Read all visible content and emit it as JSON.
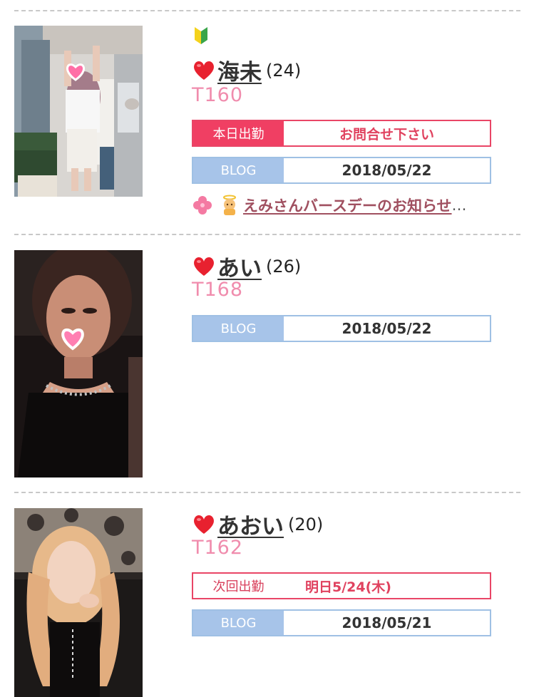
{
  "colors": {
    "divider": "#c8c8c8",
    "shift_accent": "#f03f63",
    "blog_accent": "#a7c4e9",
    "height_text": "#f08cad",
    "name_text": "#333333"
  },
  "entries": [
    {
      "name": "海未",
      "age": "(24)",
      "height": "T160",
      "beginner_mark": true,
      "heart_icon": "heart-icon",
      "photo_icon": "photo",
      "shift": {
        "label": "本日出勤",
        "value": "お問合せ下さい"
      },
      "blog": {
        "label": "BLOG",
        "date": "2018/05/22"
      },
      "news": {
        "text": "えみさんバースデーのお知らせ",
        "ellipsis": "…"
      }
    },
    {
      "name": "あい",
      "age": "(26)",
      "height": "T168",
      "beginner_mark": false,
      "heart_icon": "heart-icon",
      "photo_icon": "photo",
      "blog": {
        "label": "BLOG",
        "date": "2018/05/22"
      }
    },
    {
      "name": "あおい",
      "age": "(20)",
      "height": "T162",
      "beginner_mark": false,
      "heart_icon": "heart-icon",
      "photo_icon": "photo",
      "next_shift": {
        "label": "次回出勤",
        "value": "明日5/24(木)"
      },
      "blog": {
        "label": "BLOG",
        "date": "2018/05/21"
      }
    }
  ]
}
